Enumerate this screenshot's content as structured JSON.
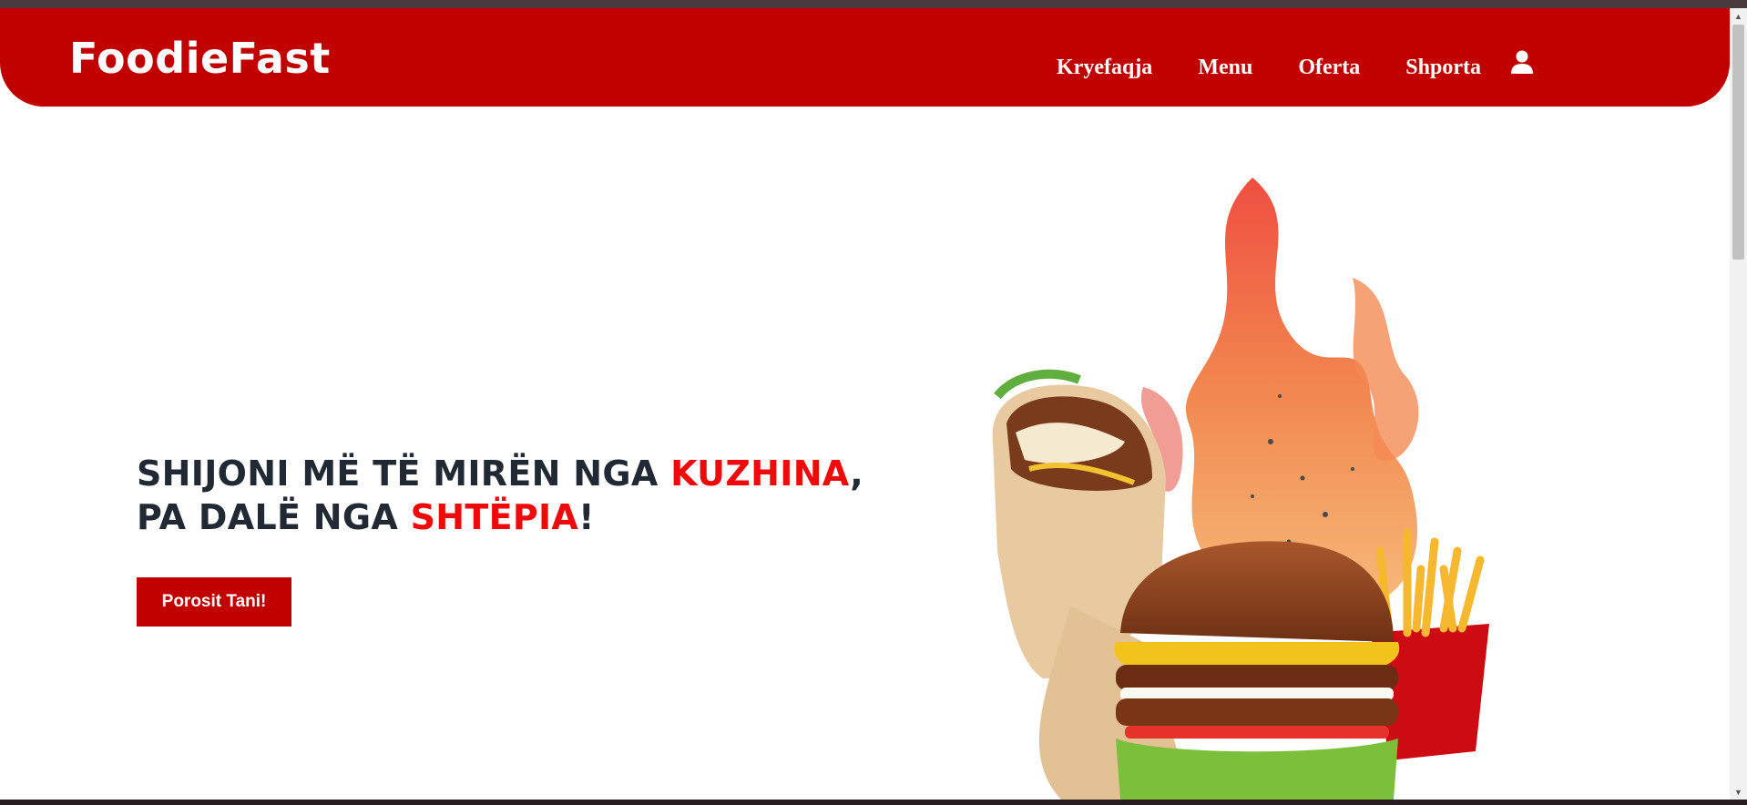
{
  "brand": {
    "name": "FoodieFast",
    "color": "#c10000",
    "accent": "#ee0a0a"
  },
  "nav": {
    "links": [
      "Kryefaqja",
      "Menu",
      "Oferta",
      "Shporta"
    ],
    "user_icon": "user-icon"
  },
  "hero": {
    "line1_part1": "SHIJONI MË TË MIRËN NGA ",
    "line1_highlight": "KUZHINA",
    "line1_part2": ",",
    "line2_part1": "PA DALË NGA ",
    "line2_highlight": "SHTËPIA",
    "line2_part2": "!",
    "cta_label": "Porosit Tani!",
    "image_icon": "food-illustration-wrap-burger-fries-fire"
  }
}
